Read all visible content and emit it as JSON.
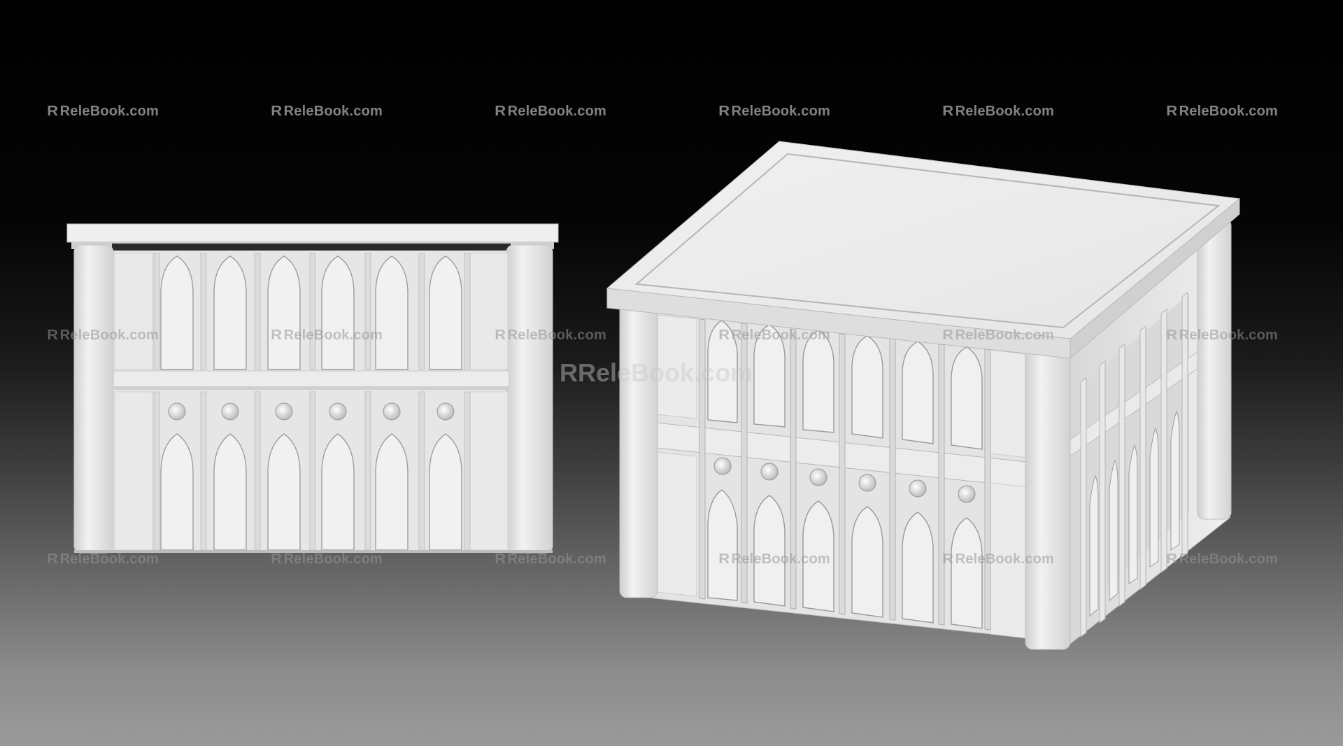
{
  "watermark": {
    "logo": "R",
    "text": "ReleBook.com"
  },
  "colors": {
    "background_top": "#000000",
    "background_bottom": "#9a9a9a",
    "model": "#e9e9e9"
  }
}
